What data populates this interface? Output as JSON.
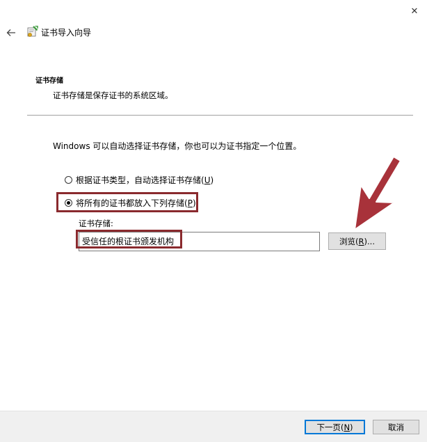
{
  "window": {
    "close_glyph": "✕",
    "back_glyph": "←",
    "title": "证书导入向导",
    "icon": "certificate-wizard-icon"
  },
  "header": {
    "section_title": "证书存储",
    "section_desc": "证书存储是保存证书的系统区域。"
  },
  "content": {
    "intro": "Windows 可以自动选择证书存储，你也可以为证书指定一个位置。",
    "radio_auto": {
      "label": "根据证书类型，自动选择证书存储(",
      "accel": "U",
      "suffix": ")",
      "checked": false
    },
    "radio_manual": {
      "label": "将所有的证书都放入下列存储(",
      "accel": "P",
      "suffix": ")",
      "checked": true
    },
    "store_label": "证书存储:",
    "store_value": "受信任的根证书颁发机构",
    "browse": {
      "label": "浏览(",
      "accel": "R",
      "suffix": ")..."
    }
  },
  "footer": {
    "next": {
      "label": "下一页(",
      "accel": "N",
      "suffix": ")"
    },
    "cancel": "取消"
  },
  "colors": {
    "highlight": "#8a2a2e",
    "arrow": "#a8323a",
    "default_button_border": "#0078d7",
    "footer_bg": "#f0f0f0"
  }
}
